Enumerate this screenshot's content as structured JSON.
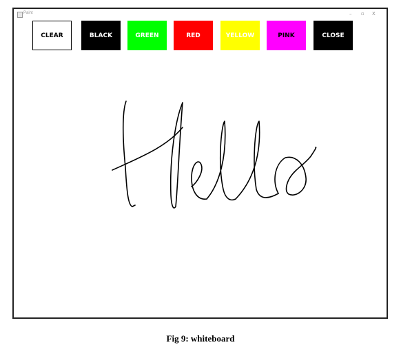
{
  "window": {
    "title": "Paint",
    "controls": {
      "minimize": "–",
      "maximize": "▫",
      "close": "X"
    }
  },
  "toolbar": {
    "clear_label": "CLEAR",
    "black_label": "BLACK",
    "green_label": "GREEN",
    "red_label": "RED",
    "yellow_label": "YELLOW",
    "pink_label": "PINK",
    "close_label": "CLOSE"
  },
  "canvas": {
    "stroke_color": "#000000",
    "background": "#ffffff"
  },
  "colors": {
    "black": "#000000",
    "green": "#00ff00",
    "red": "#ff0000",
    "yellow": "#ffff00",
    "pink": "#ff00ff"
  },
  "caption": "Fig 9: whiteboard"
}
